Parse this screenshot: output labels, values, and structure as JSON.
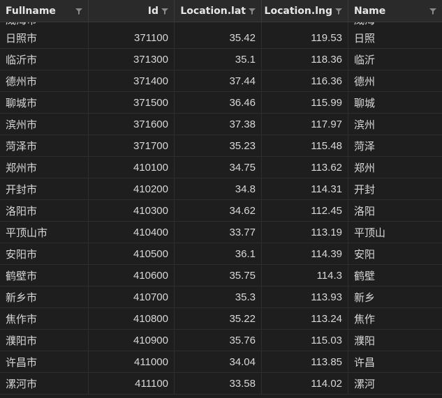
{
  "columns": [
    {
      "label": "Fullname"
    },
    {
      "label": "Id"
    },
    {
      "label": "Location.lat"
    },
    {
      "label": "Location.lng"
    },
    {
      "label": "Name"
    }
  ],
  "partial_row": {
    "fullname": "威海市",
    "name": "威海"
  },
  "rows": [
    {
      "fullname": "日照市",
      "id": "371100",
      "lat": "35.42",
      "lng": "119.53",
      "name": "日照"
    },
    {
      "fullname": "临沂市",
      "id": "371300",
      "lat": "35.1",
      "lng": "118.36",
      "name": "临沂"
    },
    {
      "fullname": "德州市",
      "id": "371400",
      "lat": "37.44",
      "lng": "116.36",
      "name": "德州"
    },
    {
      "fullname": "聊城市",
      "id": "371500",
      "lat": "36.46",
      "lng": "115.99",
      "name": "聊城"
    },
    {
      "fullname": "滨州市",
      "id": "371600",
      "lat": "37.38",
      "lng": "117.97",
      "name": "滨州"
    },
    {
      "fullname": "菏泽市",
      "id": "371700",
      "lat": "35.23",
      "lng": "115.48",
      "name": "菏泽"
    },
    {
      "fullname": "郑州市",
      "id": "410100",
      "lat": "34.75",
      "lng": "113.62",
      "name": "郑州"
    },
    {
      "fullname": "开封市",
      "id": "410200",
      "lat": "34.8",
      "lng": "114.31",
      "name": "开封"
    },
    {
      "fullname": "洛阳市",
      "id": "410300",
      "lat": "34.62",
      "lng": "112.45",
      "name": "洛阳"
    },
    {
      "fullname": "平顶山市",
      "id": "410400",
      "lat": "33.77",
      "lng": "113.19",
      "name": "平顶山"
    },
    {
      "fullname": "安阳市",
      "id": "410500",
      "lat": "36.1",
      "lng": "114.39",
      "name": "安阳"
    },
    {
      "fullname": "鹤壁市",
      "id": "410600",
      "lat": "35.75",
      "lng": "114.3",
      "name": "鹤壁"
    },
    {
      "fullname": "新乡市",
      "id": "410700",
      "lat": "35.3",
      "lng": "113.93",
      "name": "新乡"
    },
    {
      "fullname": "焦作市",
      "id": "410800",
      "lat": "35.22",
      "lng": "113.24",
      "name": "焦作"
    },
    {
      "fullname": "濮阳市",
      "id": "410900",
      "lat": "35.76",
      "lng": "115.03",
      "name": "濮阳"
    },
    {
      "fullname": "许昌市",
      "id": "411000",
      "lat": "34.04",
      "lng": "113.85",
      "name": "许昌"
    },
    {
      "fullname": "漯河市",
      "id": "411100",
      "lat": "33.58",
      "lng": "114.02",
      "name": "漯河"
    }
  ],
  "icons": {
    "filter": "filter-icon"
  },
  "colors": {
    "background": "#1e1e1e",
    "header": "#2a2a2a",
    "text": "#d8d8d8",
    "icon": "#8a8a8a"
  }
}
